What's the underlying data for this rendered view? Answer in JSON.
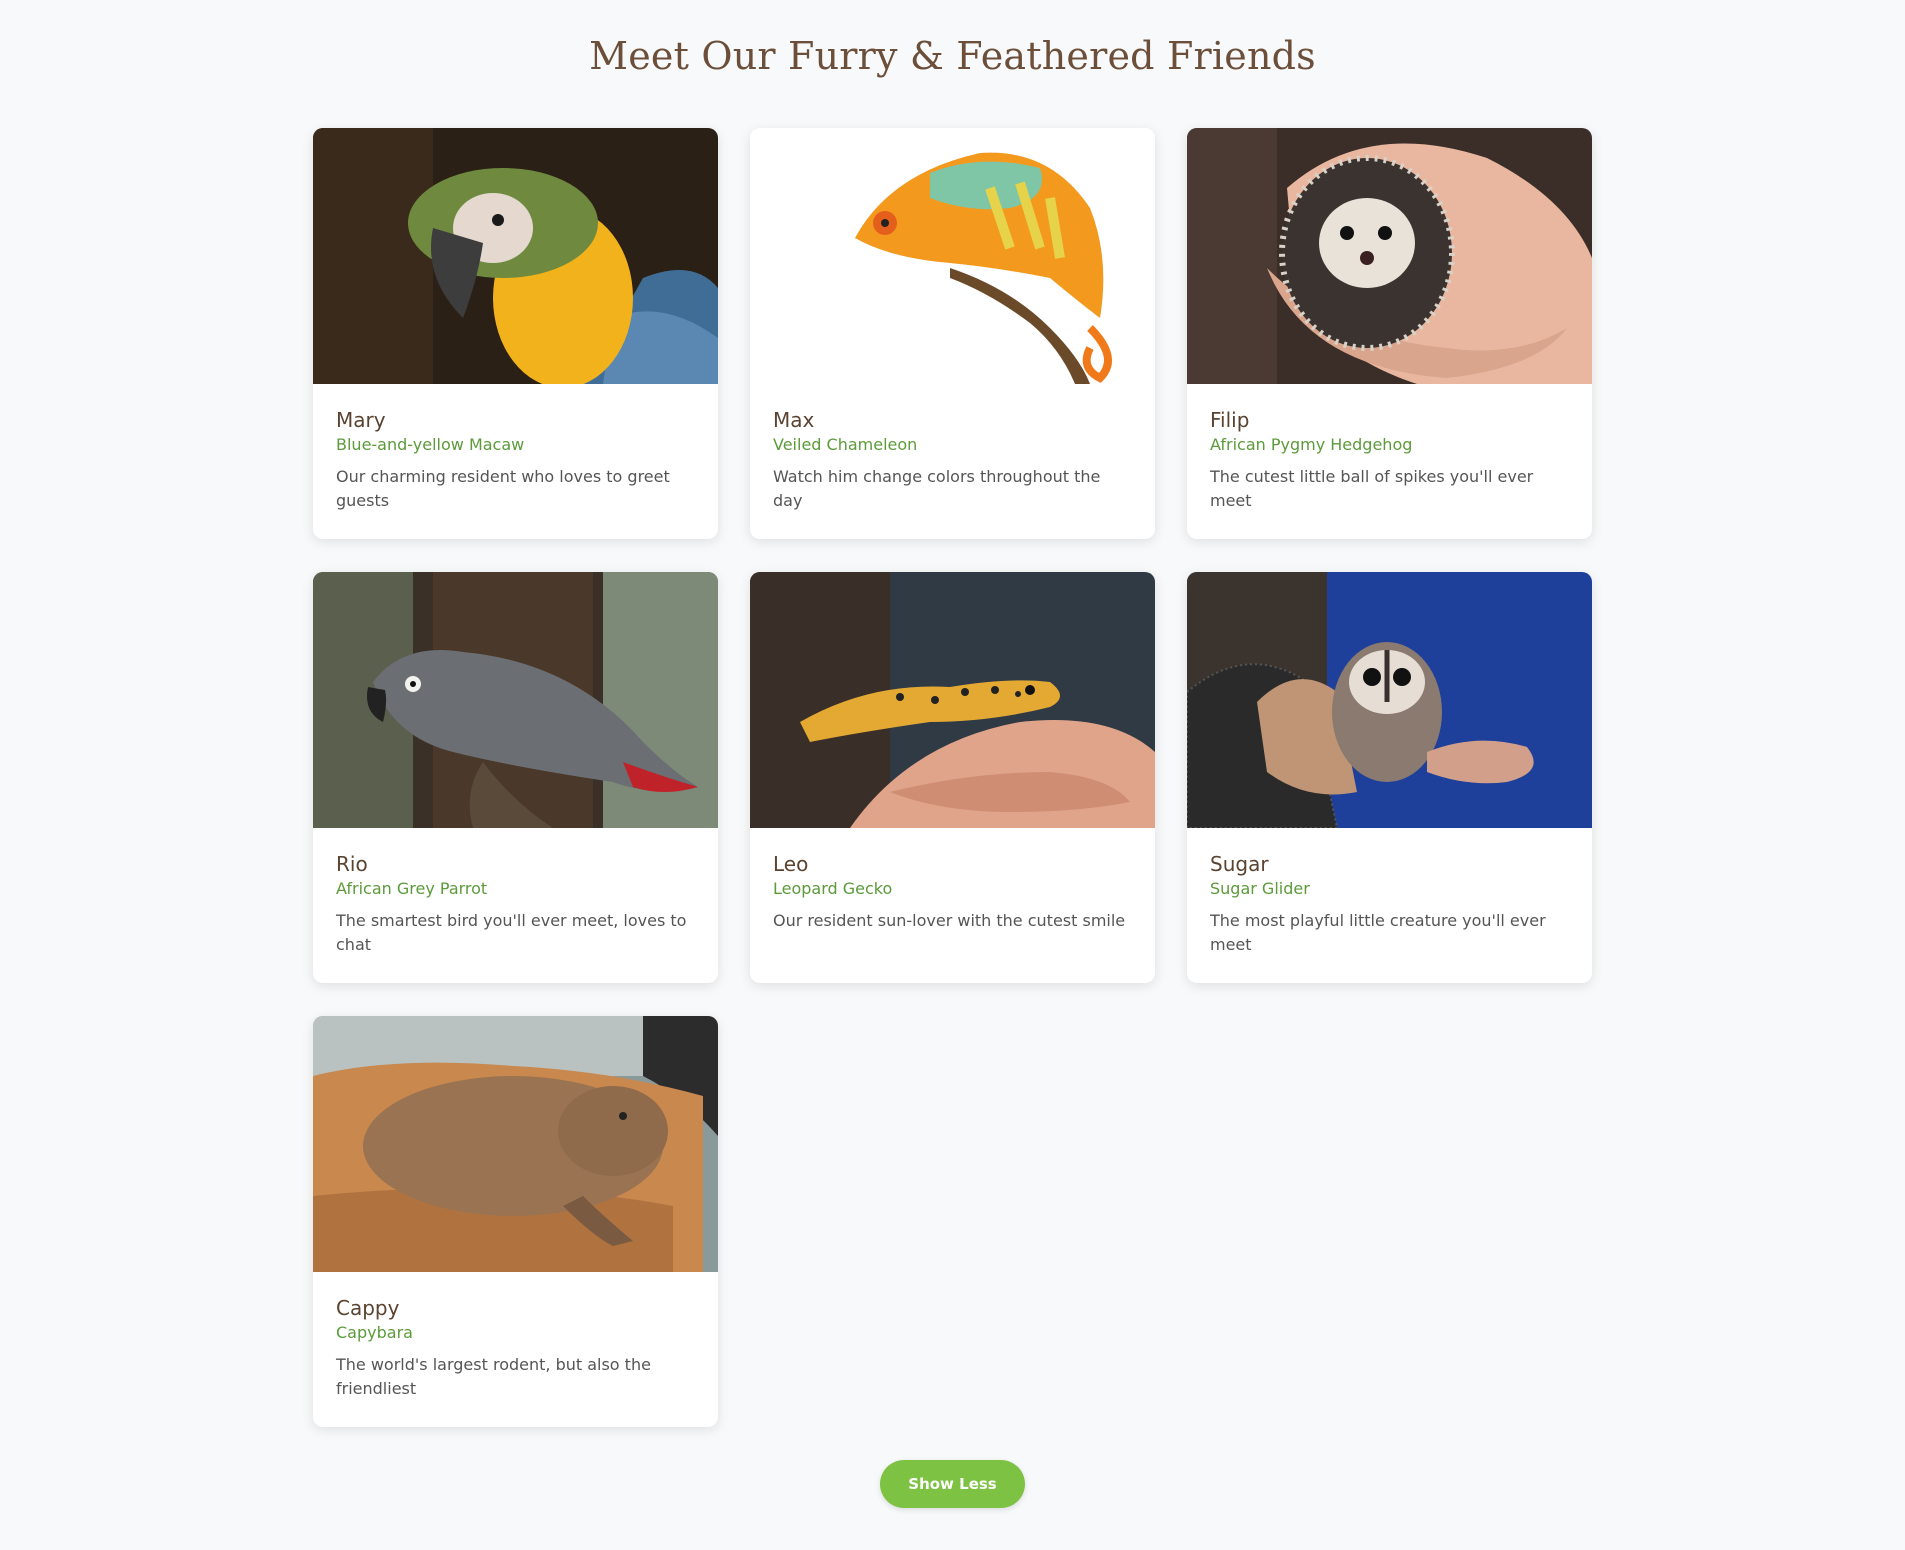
{
  "page": {
    "title": "Meet Our Furry & Feathered Friends"
  },
  "animals": [
    {
      "name": "Mary",
      "species": "Blue-and-yellow Macaw",
      "description": "Our charming resident who loves to greet guests",
      "photo_icon": "macaw-photo"
    },
    {
      "name": "Max",
      "species": "Veiled Chameleon",
      "description": "Watch him change colors throughout the day",
      "photo_icon": "chameleon-photo"
    },
    {
      "name": "Filip",
      "species": "African Pygmy Hedgehog",
      "description": "The cutest little ball of spikes you'll ever meet",
      "photo_icon": "hedgehog-photo"
    },
    {
      "name": "Rio",
      "species": "African Grey Parrot",
      "description": "The smartest bird you'll ever meet, loves to chat",
      "photo_icon": "grey-parrot-photo"
    },
    {
      "name": "Leo",
      "species": "Leopard Gecko",
      "description": "Our resident sun-lover with the cutest smile",
      "photo_icon": "gecko-photo"
    },
    {
      "name": "Sugar",
      "species": "Sugar Glider",
      "description": "The most playful little creature you'll ever meet",
      "photo_icon": "sugar-glider-photo"
    },
    {
      "name": "Cappy",
      "species": "Capybara",
      "description": "The world's largest rodent, but also the friendliest",
      "photo_icon": "capybara-photo"
    }
  ],
  "actions": {
    "show_less_label": "Show Less"
  },
  "colors": {
    "accent_green": "#7dc243",
    "title_brown": "#6b4f3a",
    "species_green": "#5c9a3a"
  }
}
